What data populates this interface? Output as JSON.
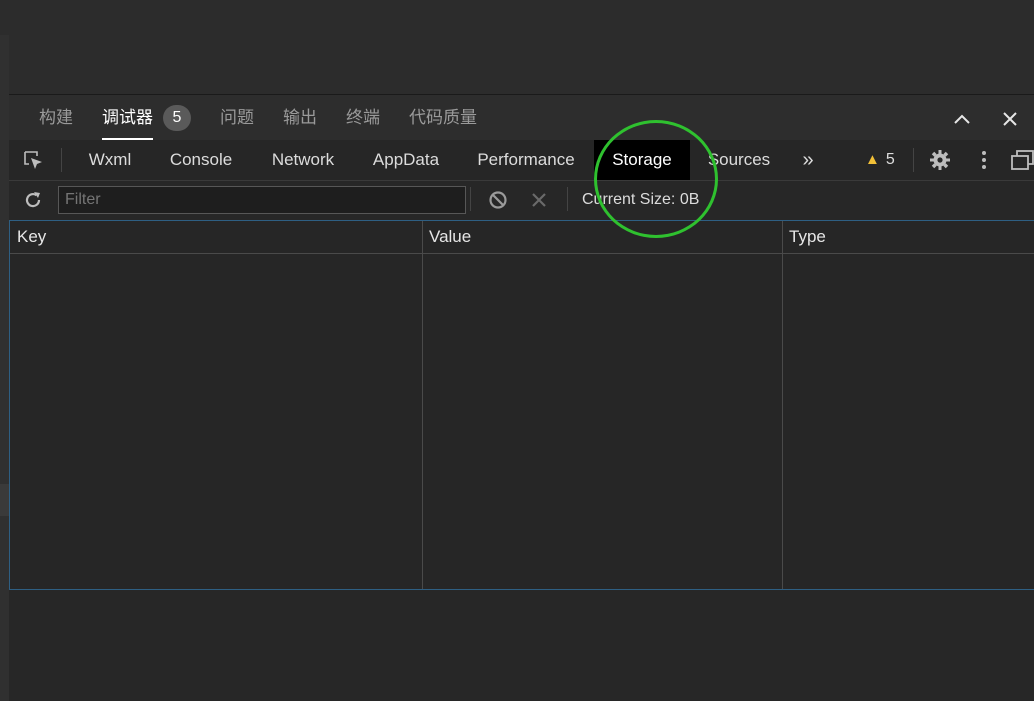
{
  "panel_tabs": [
    {
      "label": "构建",
      "active": false
    },
    {
      "label": "调试器",
      "active": true
    },
    {
      "label": "问题",
      "active": false
    },
    {
      "label": "输出",
      "active": false
    },
    {
      "label": "终端",
      "active": false
    },
    {
      "label": "代码质量",
      "active": false
    }
  ],
  "debugger_badge": "5",
  "window_controls": {
    "collapse_icon": "chevron-up-icon",
    "close_icon": "close-icon"
  },
  "dev_tabs": [
    {
      "label": "Wxml",
      "active": false
    },
    {
      "label": "Console",
      "active": false
    },
    {
      "label": "Network",
      "active": false
    },
    {
      "label": "AppData",
      "active": false
    },
    {
      "label": "Performance",
      "active": false
    },
    {
      "label": "Storage",
      "active": true
    },
    {
      "label": "Sources",
      "active": false
    }
  ],
  "more_tabs_glyph": "»",
  "warnings": {
    "count": "5",
    "icon": "warning-icon",
    "color": "#f2c037"
  },
  "toolbar_icons": [
    "settings-gear-icon",
    "more-vertical-icon",
    "dock-icon"
  ],
  "filter": {
    "placeholder": "Filter",
    "value": ""
  },
  "current_size": "Current Size: 0B",
  "table": {
    "columns": [
      "Key",
      "Value",
      "Type"
    ],
    "rows": []
  },
  "annotation": {
    "color": "#2fc12f"
  }
}
